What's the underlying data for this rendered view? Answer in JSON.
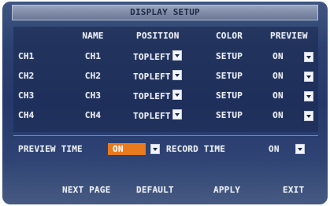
{
  "title": "DISPLAY SETUP",
  "headers": {
    "name": "NAME",
    "position": "POSITION",
    "color": "COLOR",
    "preview": "PREVIEW"
  },
  "channels": [
    {
      "ch": "CH1",
      "name": "CH1",
      "position": "TOPLEFT",
      "color": "SETUP",
      "preview": "ON"
    },
    {
      "ch": "CH2",
      "name": "CH2",
      "position": "TOPLEFT",
      "color": "SETUP",
      "preview": "ON"
    },
    {
      "ch": "CH3",
      "name": "CH3",
      "position": "TOPLEFT",
      "color": "SETUP",
      "preview": "ON"
    },
    {
      "ch": "CH4",
      "name": "CH4",
      "position": "TOPLEFT",
      "color": "SETUP",
      "preview": "ON"
    }
  ],
  "time_settings": {
    "preview_time_label": "PREVIEW TIME",
    "preview_time_value": "ON",
    "record_time_label": "RECORD TIME",
    "record_time_value": "ON"
  },
  "buttons": {
    "next_page": "NEXT PAGE",
    "default": "DEFAULT",
    "apply": "APPLY",
    "exit": "EXIT"
  },
  "colors": {
    "background": "#2c4170",
    "title_bar": "#7e8aa6",
    "highlight": "#ea7a1e",
    "text": "#e8ecf4"
  },
  "icons": {
    "dropdown": "dropdown-arrow-icon"
  }
}
